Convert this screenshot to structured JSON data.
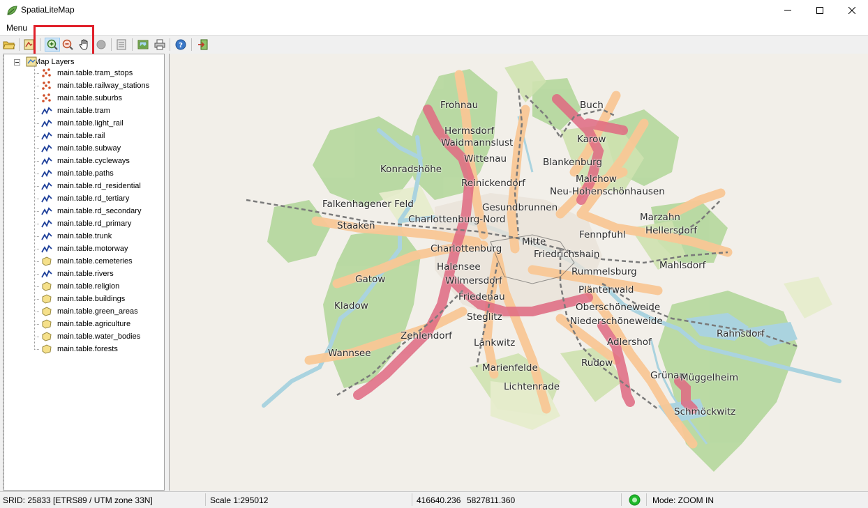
{
  "window": {
    "title": "SpatiaLiteMap",
    "minimize_glyph": "—",
    "maximize_glyph": "☐",
    "close_glyph": "✕"
  },
  "menubar": {
    "menu_label": "Menu"
  },
  "toolbar": {
    "buttons": [
      {
        "icon": "open-folder-icon"
      },
      {
        "icon": "layer-config-icon"
      },
      {
        "icon": "zoom-in-icon"
      },
      {
        "icon": "zoom-out-icon"
      },
      {
        "icon": "pan-hand-icon"
      },
      {
        "icon": "identify-disabled-icon"
      },
      {
        "icon": "properties-icon"
      },
      {
        "icon": "export-image-icon"
      },
      {
        "icon": "print-icon"
      },
      {
        "icon": "help-icon"
      },
      {
        "icon": "exit-icon"
      }
    ],
    "highlight_color": "#e0202a"
  },
  "tree": {
    "root_label": "Map Layers",
    "layers": [
      {
        "label": "main.table.tram_stops",
        "icon": "point-layer-icon"
      },
      {
        "label": "main.table.railway_stations",
        "icon": "point-layer-icon"
      },
      {
        "label": "main.table.suburbs",
        "icon": "point-layer-icon"
      },
      {
        "label": "main.table.tram",
        "icon": "line-layer-icon"
      },
      {
        "label": "main.table.light_rail",
        "icon": "line-layer-icon"
      },
      {
        "label": "main.table.rail",
        "icon": "line-layer-icon"
      },
      {
        "label": "main.table.subway",
        "icon": "line-layer-icon"
      },
      {
        "label": "main.table.cycleways",
        "icon": "line-layer-icon"
      },
      {
        "label": "main.table.paths",
        "icon": "line-layer-icon"
      },
      {
        "label": "main.table.rd_residential",
        "icon": "line-layer-icon"
      },
      {
        "label": "main.table.rd_tertiary",
        "icon": "line-layer-icon"
      },
      {
        "label": "main.table.rd_secondary",
        "icon": "line-layer-icon"
      },
      {
        "label": "main.table.rd_primary",
        "icon": "line-layer-icon"
      },
      {
        "label": "main.table.trunk",
        "icon": "line-layer-icon"
      },
      {
        "label": "main.table.motorway",
        "icon": "line-layer-icon"
      },
      {
        "label": "main.table.cemeteries",
        "icon": "polygon-layer-icon"
      },
      {
        "label": "main.table.rivers",
        "icon": "line-layer-icon"
      },
      {
        "label": "main.table.religion",
        "icon": "polygon-layer-icon"
      },
      {
        "label": "main.table.buildings",
        "icon": "polygon-layer-icon"
      },
      {
        "label": "main.table.green_areas",
        "icon": "polygon-layer-icon"
      },
      {
        "label": "main.table.agriculture",
        "icon": "polygon-layer-icon"
      },
      {
        "label": "main.table.water_bodies",
        "icon": "polygon-layer-icon"
      },
      {
        "label": "main.table.forests",
        "icon": "polygon-layer-icon"
      }
    ]
  },
  "map": {
    "background_color": "#f2efe9",
    "places": [
      {
        "name": "Frohnau"
      },
      {
        "name": "Buch"
      },
      {
        "name": "Hermsdorf"
      },
      {
        "name": "Waidmannslust"
      },
      {
        "name": "Karow"
      },
      {
        "name": "Wittenau"
      },
      {
        "name": "Blankenburg"
      },
      {
        "name": "Konradshöhe"
      },
      {
        "name": "Malchow"
      },
      {
        "name": "Reinickendorf"
      },
      {
        "name": "Neu-Hohenschönhausen"
      },
      {
        "name": "Falkenhagener Feld"
      },
      {
        "name": "Gesundbrunnen"
      },
      {
        "name": "Charlottenburg-Nord"
      },
      {
        "name": "Marzahn"
      },
      {
        "name": "Staaken"
      },
      {
        "name": "Hellersdorf"
      },
      {
        "name": "Fennpfuhl"
      },
      {
        "name": "Mitte"
      },
      {
        "name": "Charlottenburg"
      },
      {
        "name": "Friedrichshain"
      },
      {
        "name": "Halensee"
      },
      {
        "name": "Mahlsdorf"
      },
      {
        "name": "Rummelsburg"
      },
      {
        "name": "Gatow"
      },
      {
        "name": "Wilmersdorf"
      },
      {
        "name": "Plänterwald"
      },
      {
        "name": "Friedenau"
      },
      {
        "name": "Kladow"
      },
      {
        "name": "Oberschöneweide"
      },
      {
        "name": "Steglitz"
      },
      {
        "name": "Niederschöneweide"
      },
      {
        "name": "Rahnsdorf"
      },
      {
        "name": "Zehlendorf"
      },
      {
        "name": "Adlershof"
      },
      {
        "name": "Lankwitz"
      },
      {
        "name": "Wannsee"
      },
      {
        "name": "Rudow"
      },
      {
        "name": "Marienfelde"
      },
      {
        "name": "Grünau"
      },
      {
        "name": "Müggelheim"
      },
      {
        "name": "Lichtenrade"
      },
      {
        "name": "Schmöckwitz"
      }
    ]
  },
  "status": {
    "srid": "SRID: 25833 [ETRS89 / UTM zone 33N]",
    "scale": "Scale 1:295012",
    "x": "416640.236",
    "y": "5827811.360",
    "mode": "Mode: ZOOM IN",
    "mode_indicator_color": "#1fb82a"
  }
}
